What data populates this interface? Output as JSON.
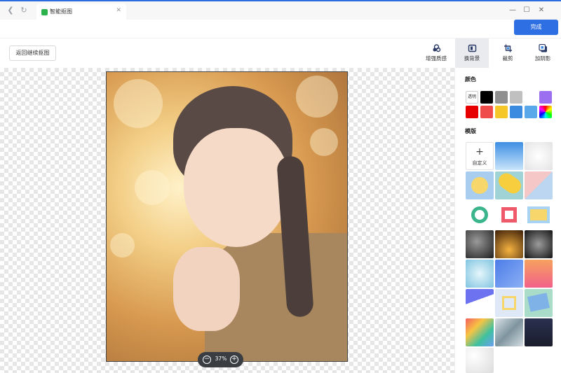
{
  "titlebar": {
    "tab_title": "智能抠图",
    "back_icon": "back-arrow-icon",
    "refresh_icon": "refresh-icon",
    "close_tab_icon": "close-icon",
    "window_controls": [
      "minimize-icon",
      "maximize-icon",
      "close-icon"
    ]
  },
  "actions": {
    "done_label": "完成",
    "accent": "#2f6fe4"
  },
  "toolbar": {
    "back_label": "返回继续抠图",
    "tools": [
      {
        "label": "增强质感",
        "icon": "enhance-icon",
        "active": false
      },
      {
        "label": "换背景",
        "icon": "background-icon",
        "active": true
      },
      {
        "label": "裁剪",
        "icon": "crop-icon",
        "active": false
      },
      {
        "label": "加阴影",
        "icon": "shadow-icon",
        "active": false
      }
    ]
  },
  "canvas": {
    "zoom": "37%",
    "zoom_out_icon": "zoom-out-icon",
    "zoom_in_icon": "zoom-in-icon"
  },
  "panel": {
    "colors_title": "颜色",
    "transparent_label": "透明",
    "colors": [
      "#000000",
      "#8f8f8f",
      "#c0c0c0",
      "#ffffff",
      "#9b6ff0",
      "#e60000",
      "#ef4b4b",
      "#f5c728",
      "#3b8be0",
      "#58a8ea",
      "rainbow"
    ],
    "templates_title": "模版",
    "custom_label": "自定义"
  }
}
